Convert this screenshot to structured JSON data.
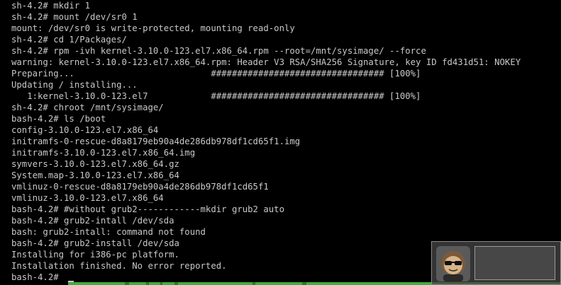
{
  "terminal": {
    "lines": [
      "sh-4.2# mkdir 1",
      "sh-4.2# mount /dev/sr0 1",
      "mount: /dev/sr0 is write-protected, mounting read-only",
      "sh-4.2# cd 1/Packages/",
      "sh-4.2# rpm -ivh kernel-3.10.0-123.el7.x86_64.rpm --root=/mnt/sysimage/ --force",
      "warning: kernel-3.10.0-123.el7.x86_64.rpm: Header V3 RSA/SHA256 Signature, key ID fd431d51: NOKEY",
      "Preparing...                          ################################# [100%]",
      "Updating / installing...",
      "   1:kernel-3.10.0-123.el7            ################################# [100%]",
      "sh-4.2# chroot /mnt/sysimage/",
      "bash-4.2# ls /boot",
      "config-3.10.0-123.el7.x86_64",
      "initramfs-0-rescue-d8a8179eb90a4de286db978df1cd65f1.img",
      "initramfs-3.10.0-123.el7.x86_64.img",
      "symvers-3.10.0-123.el7.x86_64.gz",
      "System.map-3.10.0-123.el7.x86_64",
      "vmlinuz-0-rescue-d8a8179eb90a4de286db978df1cd65f1",
      "vmlinuz-3.10.0-123.el7.x86_64",
      "bash-4.2# #without grub2------------mkdir grub2 auto",
      "bash-4.2# grub2-intall /dev/sda",
      "bash: grub2-intall: command not found",
      "bash-4.2# grub2-install /dev/sda",
      "Installing for i386-pc platform.",
      "Installation finished. No error reported.",
      "bash-4.2# "
    ]
  },
  "colors": {
    "background": "#000000",
    "foreground": "#c8c8c8",
    "status_strip": "#3fae3f"
  },
  "icons": {
    "watermark": "avatar-with-sunglasses-icon"
  }
}
